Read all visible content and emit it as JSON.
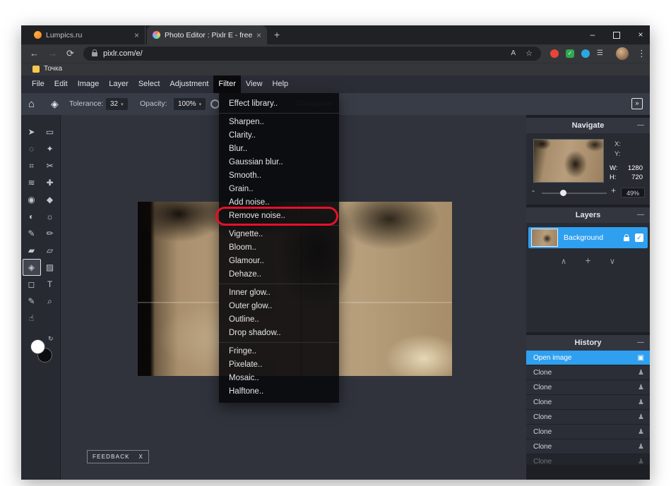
{
  "window_controls": {
    "minimize": "–",
    "close": "×"
  },
  "browser": {
    "tab1": {
      "title": "Lumpics.ru",
      "close": "×"
    },
    "tab2": {
      "title": "Photo Editor : Pixlr E - free imag",
      "close": "×"
    },
    "new_tab": "+",
    "nav": {
      "back": "←",
      "forward": "→",
      "refresh": "⟳"
    },
    "address": "pixlr.com/e/",
    "omnibox_icons": {
      "translate": "A",
      "star": "☆"
    },
    "extension_icons": {
      "check": "✓"
    },
    "side_panel": "☰",
    "more": "⋮",
    "bookmark": "Точка"
  },
  "menubar": {
    "items": [
      "File",
      "Edit",
      "Image",
      "Layer",
      "Select",
      "Adjustment",
      "Filter",
      "View",
      "Help"
    ]
  },
  "toolbar": {
    "home": "⌂",
    "active_tool": "◈",
    "tolerance_label": "Tolerance:",
    "tolerance_value": "32",
    "opacity_label": "Opacity:",
    "opacity_value": "100%",
    "contiguous_label": "Contiguous",
    "caret": "▾",
    "panel_toggle": "»"
  },
  "tools": [
    "➤",
    "▭",
    "◌",
    "✦",
    "⌗",
    "✂",
    "≋",
    "✚",
    "◉",
    "◆",
    "◐",
    "☼",
    "✎",
    "✏",
    "▰",
    "▱",
    "◈",
    "▨",
    "◻",
    "T",
    "✎",
    "⌕",
    "☝"
  ],
  "swatch_reset": "↻",
  "filter_menu": {
    "items": [
      "Effect library..",
      "Sharpen..",
      "Clarity..",
      "Blur..",
      "Gaussian blur..",
      "Smooth..",
      "Grain..",
      "Add noise..",
      "Remove noise..",
      "Vignette..",
      "Bloom..",
      "Glamour..",
      "Dehaze..",
      "Inner glow..",
      "Outer glow..",
      "Outline..",
      "Drop shadow..",
      "Fringe..",
      "Pixelate..",
      "Mosaic..",
      "Halftone.."
    ],
    "highlighted": "Remove noise.."
  },
  "navigate": {
    "title": "Navigate",
    "collapse": "—",
    "x_label": "X:",
    "y_label": "Y:",
    "w_label": "W:",
    "w_value": "1280",
    "h_label": "H:",
    "h_value": "720",
    "zoom_out": "-",
    "zoom_in": "+",
    "zoom_value": "49%"
  },
  "layers": {
    "title": "Layers",
    "collapse": "—",
    "background_label": "Background",
    "check": "✓",
    "up": "∧",
    "add": "+",
    "down": "∨"
  },
  "history": {
    "title": "History",
    "collapse": "—",
    "open_icon": "▣",
    "clone_icon": "♟",
    "items": [
      "Open image",
      "Clone",
      "Clone",
      "Clone",
      "Clone",
      "Clone",
      "Clone",
      "Clone"
    ]
  },
  "feedback": {
    "label": "FEEDBACK",
    "close": "X"
  },
  "colors": {
    "accent": "#2f9ff0",
    "annotation": "#e6102c"
  }
}
